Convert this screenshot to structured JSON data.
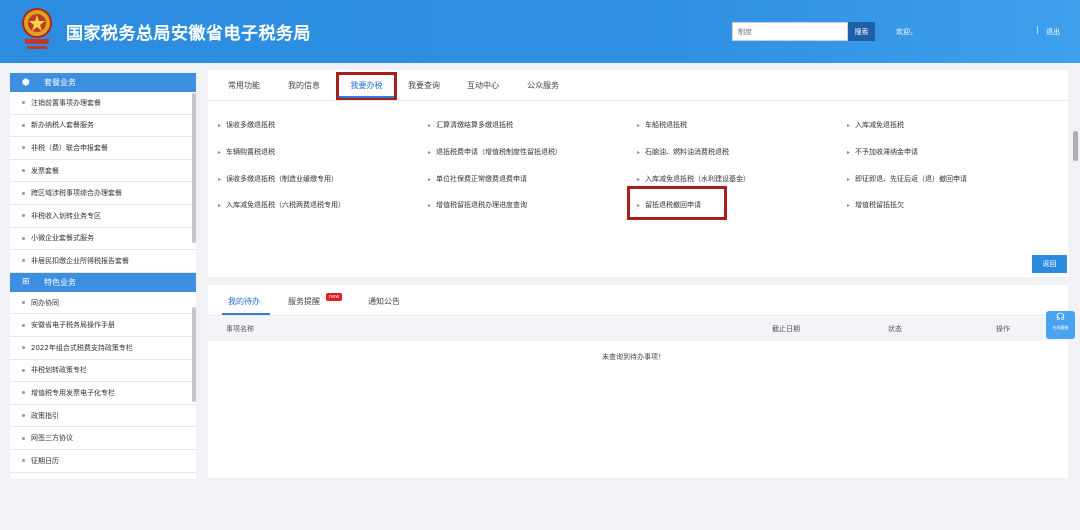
{
  "header": {
    "title": "国家税务总局安徽省电子税务局",
    "search_placeholder": "制度",
    "search_button": "搜索",
    "welcome": "欢迎，",
    "user_masked": " ",
    "separator": "|",
    "logout": "退出",
    "emblem_icon": "tax-emblem-icon"
  },
  "sidebar": {
    "package_section": {
      "title": "套餐业务",
      "items": [
        "注销前置事项办理套餐",
        "新办纳税人套餐服务",
        "非税（费）联合申报套餐",
        "发票套餐",
        "跨区域涉税事项综合办理套餐",
        "非税收入划转业务专区",
        "小微企业套餐式服务",
        "非居民扣缴企业所得税报告套餐"
      ]
    },
    "feature_section": {
      "title": "特色业务",
      "items": [
        "同办协同",
        "安徽省电子税务局操作手册",
        "2022年组合式税费支持政策专栏",
        "非税划转政策专栏",
        "增值税专用发票电子化专栏",
        "政策指引",
        "网签三方协议",
        "征期日历"
      ]
    }
  },
  "main": {
    "tabs": [
      "常用功能",
      "我的信息",
      "我要办税",
      "我要查询",
      "互动中心",
      "公众服务"
    ],
    "active_tab": "我要办税",
    "links": [
      [
        "误收多缴退抵税",
        "汇算清缴结算多缴退抵税",
        "车船税退抵税",
        "入库减免退抵税"
      ],
      [
        "车辆购置税退税",
        "退抵税费申请（增值税制度性留抵退税）",
        "石脑油、燃料油消费税退税",
        "不予加收滞纳金申请"
      ],
      [
        "误收多缴退抵税（制造业缓缴专用）",
        "单位社保费正常缴费退费申请",
        "入库减免退抵税（水利建设基金）",
        "即征即退、先征后返（退）撤回申请"
      ],
      [
        "入库减免退抵税（六税两费退税专用）",
        "增值税留抵退税办理进度查询",
        "留抵退税撤回申请",
        "增值税留抵抵欠"
      ]
    ],
    "back_button": "返回"
  },
  "todo": {
    "tabs": [
      "我的待办",
      "服务提醒",
      "通知公告"
    ],
    "new_badge": "new",
    "columns": [
      "事项名称",
      "截止日期",
      "状态",
      "操作"
    ],
    "empty_message": "未查询到待办事项！"
  },
  "float_widget": {
    "label": "在线客服",
    "icon": "headset-icon"
  },
  "colors": {
    "header_blue": "#2e8fe2",
    "highlight_red": "#a8201a",
    "active_blue": "#1f6fd0"
  }
}
